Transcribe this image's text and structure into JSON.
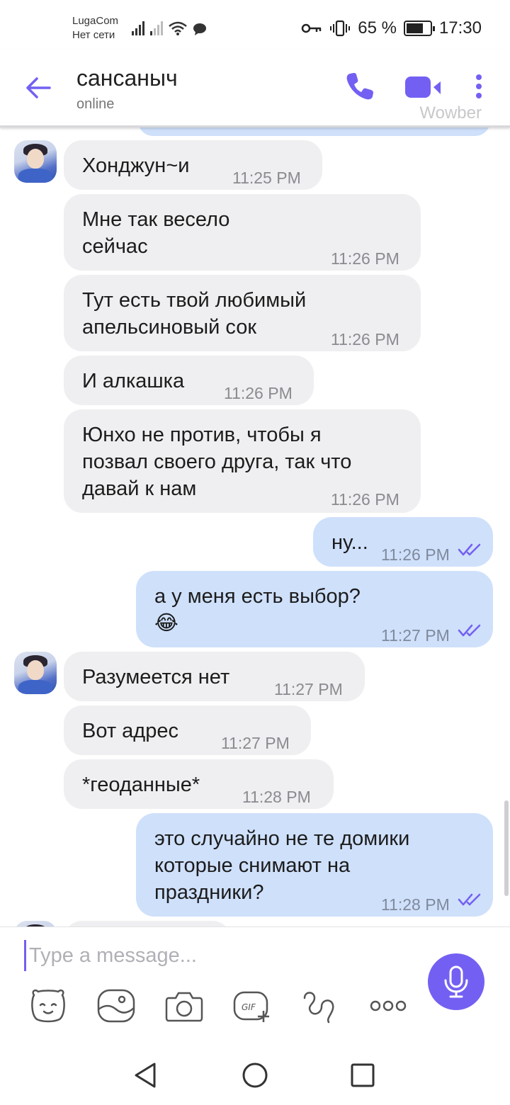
{
  "status_bar": {
    "carrier": "LugaCom",
    "network": "Нет сети",
    "battery_percent_label": "65 %",
    "battery_level": 0.65,
    "time": "17:30"
  },
  "header": {
    "title": "сансаныч",
    "status": "online",
    "watermark": "Wowber",
    "accent_color": "#7360f2"
  },
  "messages": [
    {
      "dir": "in",
      "text": "Хонджун~и",
      "time": "11:25 PM",
      "avatar": true
    },
    {
      "dir": "in",
      "lines": [
        "Мне так весело",
        "сейчас"
      ],
      "time": "11:26 PM"
    },
    {
      "dir": "in",
      "lines": [
        "Тут есть твой любимый",
        "апельсиновый сок"
      ],
      "time": "11:26 PM"
    },
    {
      "dir": "in",
      "text": "И алкашка",
      "time": "11:26 PM"
    },
    {
      "dir": "in",
      "lines": [
        "Юнхо не против, чтобы я",
        "позвал своего друга, так что",
        "давай к нам"
      ],
      "time": "11:26 PM"
    },
    {
      "dir": "out",
      "text": "ну...",
      "time": "11:26 PM",
      "read": true
    },
    {
      "dir": "out",
      "lines": [
        "а у меня есть выбор?",
        "😂"
      ],
      "time": "11:27 PM",
      "read": true
    },
    {
      "dir": "in",
      "text": "Разумеется нет",
      "time": "11:27 PM",
      "avatar": true
    },
    {
      "dir": "in",
      "text": "Вот адрес",
      "time": "11:27 PM"
    },
    {
      "dir": "in",
      "text": "*геоданные*",
      "time": "11:28 PM"
    },
    {
      "dir": "out",
      "lines": [
        "это случайно не те домики",
        "которые снимают на",
        "праздники?"
      ],
      "time": "11:28 PM",
      "read": true
    }
  ],
  "composer": {
    "placeholder": "Type a message...",
    "tools": [
      "sticker-icon",
      "image-icon",
      "camera-icon",
      "gif-icon",
      "doodle-icon",
      "more-icon"
    ]
  },
  "colors": {
    "incoming_bubble": "#efeff1",
    "outgoing_bubble": "#cfe0fb",
    "accent": "#7360f2"
  }
}
